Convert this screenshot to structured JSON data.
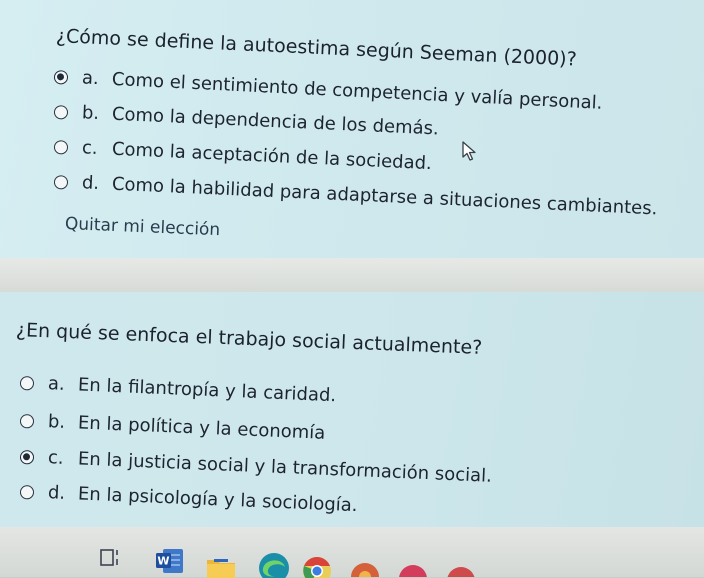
{
  "question1": {
    "text": "¿Cómo se define la autoestima según Seeman (2000)?",
    "options": [
      {
        "letter": "a.",
        "text": "Como el sentimiento de competencia y valía personal.",
        "selected": true
      },
      {
        "letter": "b.",
        "text": "Como la dependencia de los demás.",
        "selected": false
      },
      {
        "letter": "c.",
        "text": "Como la aceptación de la sociedad.",
        "selected": false
      },
      {
        "letter": "d.",
        "text": "Como la habilidad para adaptarse a situaciones cambiantes.",
        "selected": false
      }
    ],
    "clear_choice": "Quitar mi elección"
  },
  "question2": {
    "text": "¿En qué se enfoca el trabajo social actualmente?",
    "options": [
      {
        "letter": "a.",
        "text": "En la filantropía y la caridad.",
        "selected": false
      },
      {
        "letter": "b.",
        "text": "En la política y la economía",
        "selected": false
      },
      {
        "letter": "c.",
        "text": "En la justicia social y la transformación social.",
        "selected": true
      },
      {
        "letter": "d.",
        "text": "En la psicología y la sociología.",
        "selected": false
      }
    ]
  },
  "taskbar": {
    "icons": [
      "task-view-icon",
      "word-icon",
      "folder-icon",
      "edge-icon",
      "chrome-icon"
    ],
    "word_label": "W"
  },
  "colors": {
    "card_background": "#cfe9ee",
    "page_background": "#e6e9e6",
    "text": "#1d2430",
    "link": "#2a3d4f"
  }
}
